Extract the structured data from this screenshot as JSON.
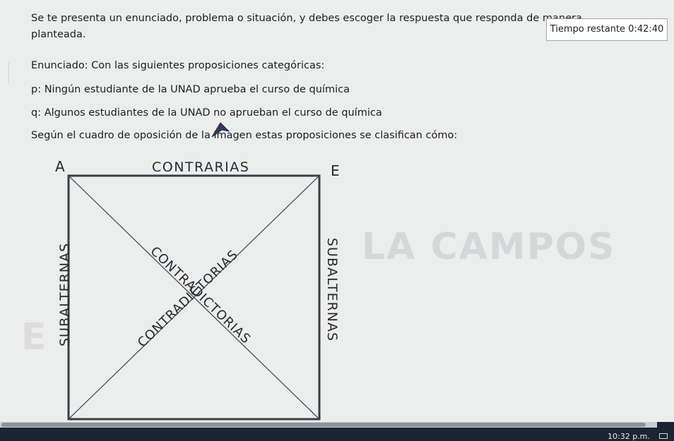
{
  "instructions": {
    "line1": "Se te presenta un enunciado, problema o situación, y debes escoger la respuesta que responda de manera",
    "line2": "planteada."
  },
  "timer": {
    "label": "Tiempo restante 0:42:40"
  },
  "statement": {
    "intro": "Enunciado: Con las siguientes proposiciones categóricas:",
    "p": "p: Ningún estudiante de la UNAD aprueba el curso de química",
    "q": "q: Algunos estudiantes de la UNAD no aprueban el curso de química",
    "question": "Según el cuadro de oposición de la imagen estas proposiciones se clasifican cómo:"
  },
  "diagram": {
    "corner_a": "A",
    "corner_e": "E",
    "top_label": "CONTRARIAS",
    "left_label": "SUBALTERNAS",
    "right_label": "SUBALTERNAS",
    "diag1": "CONTRADICTORIAS",
    "diag2": "CONTRADICTORIAS"
  },
  "watermark": {
    "text": "LA CAMPOS",
    "text2": "E"
  },
  "taskbar": {
    "clock": "10:32 p.m."
  },
  "colors": {
    "page": "#eceded",
    "ink": "#1e1e22",
    "taskbar": "#1b2433"
  }
}
